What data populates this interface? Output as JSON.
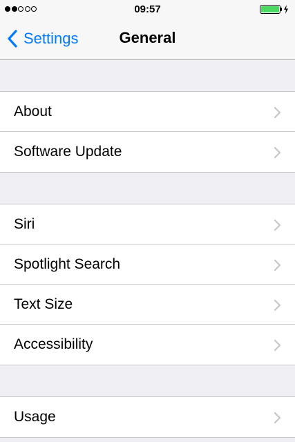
{
  "status_bar": {
    "signal_filled": 2,
    "signal_total": 5,
    "time": "09:57",
    "battery_level": 1.0,
    "charging": true,
    "battery_color": "#4cd964"
  },
  "nav": {
    "back_label": "Settings",
    "back_icon": "chevron-left-icon",
    "title": "General",
    "accent_color": "#007aff"
  },
  "groups": [
    {
      "rows": [
        {
          "label": "About",
          "icon": "chevron-right-icon"
        },
        {
          "label": "Software Update",
          "icon": "chevron-right-icon"
        }
      ]
    },
    {
      "rows": [
        {
          "label": "Siri",
          "icon": "chevron-right-icon"
        },
        {
          "label": "Spotlight Search",
          "icon": "chevron-right-icon"
        },
        {
          "label": "Text Size",
          "icon": "chevron-right-icon"
        },
        {
          "label": "Accessibility",
          "icon": "chevron-right-icon"
        }
      ]
    },
    {
      "rows": [
        {
          "label": "Usage",
          "icon": "chevron-right-icon"
        }
      ]
    }
  ]
}
